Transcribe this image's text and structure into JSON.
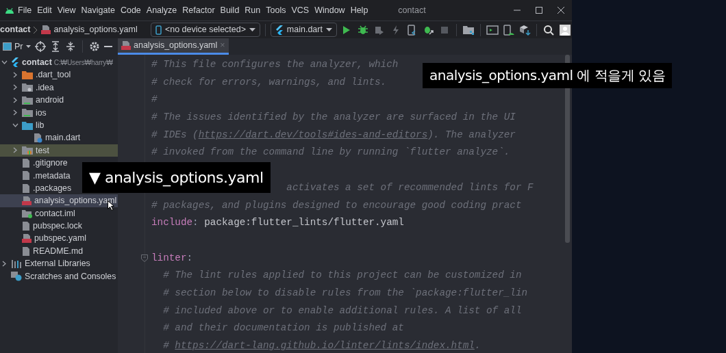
{
  "window": {
    "title": "contact"
  },
  "menu": [
    "File",
    "Edit",
    "View",
    "Navigate",
    "Code",
    "Analyze",
    "Refactor",
    "Build",
    "Run",
    "Tools",
    "VCS",
    "Window",
    "Help"
  ],
  "breadcrumb": [
    {
      "label": "contact",
      "kind": "project"
    },
    {
      "label": "analysis_options.yaml",
      "kind": "yaml-file"
    }
  ],
  "device_selector": {
    "label": "<no device selected>"
  },
  "run_config": {
    "label": "main.dart"
  },
  "project_view": {
    "label": "Pr"
  },
  "editor_tabs": [
    {
      "label": "analysis_options.yaml",
      "close": "×",
      "selected": true
    }
  ],
  "project_tree": [
    {
      "label": "contact",
      "path": "C:₩Users₩harry₩",
      "kind": "flutter",
      "expanded": true,
      "selected": false,
      "highlighted": false,
      "children": [
        {
          "label": ".dart_tool",
          "kind": "folder-excluded",
          "expanded": false,
          "selected": false,
          "highlighted": false
        },
        {
          "label": ".idea",
          "kind": "folder-config",
          "expanded": false,
          "selected": false,
          "highlighted": false
        },
        {
          "label": "android",
          "kind": "folder-module",
          "expanded": false,
          "selected": false,
          "highlighted": false
        },
        {
          "label": "ios",
          "kind": "folder-module",
          "expanded": false,
          "selected": false,
          "highlighted": false
        },
        {
          "label": "lib",
          "kind": "folder-source",
          "expanded": true,
          "selected": false,
          "highlighted": false,
          "children": [
            {
              "label": "main.dart",
              "kind": "dart-file",
              "selected": false,
              "highlighted": false
            }
          ]
        },
        {
          "label": "test",
          "kind": "folder-test",
          "expanded": false,
          "selected": false,
          "highlighted": true
        },
        {
          "label": ".gitignore",
          "kind": "file",
          "selected": false,
          "highlighted": false
        },
        {
          "label": ".metadata",
          "kind": "file",
          "selected": false,
          "highlighted": false
        },
        {
          "label": ".packages",
          "kind": "file",
          "selected": false,
          "highlighted": false
        },
        {
          "label": "analysis_options.yaml",
          "kind": "yaml-file",
          "selected": true,
          "highlighted": false
        },
        {
          "label": "contact.iml",
          "kind": "module-file",
          "selected": false,
          "highlighted": false
        },
        {
          "label": "pubspec.lock",
          "kind": "file",
          "selected": false,
          "highlighted": false
        },
        {
          "label": "pubspec.yaml",
          "kind": "yaml-file",
          "selected": false,
          "highlighted": false
        },
        {
          "label": "README.md",
          "kind": "file",
          "selected": false,
          "highlighted": false
        }
      ]
    },
    {
      "label": "External Libraries",
      "kind": "libraries",
      "expanded": false,
      "selected": false,
      "highlighted": false
    },
    {
      "label": "Scratches and Consoles",
      "kind": "scratches",
      "selected": false,
      "highlighted": false
    }
  ],
  "code_lines": [
    {
      "kind": "full",
      "foldable": false,
      "segments": [
        {
          "kind": "comment",
          "text": "# This file configures the analyzer, which"
        }
      ]
    },
    {
      "kind": "full",
      "foldable": false,
      "segments": [
        {
          "kind": "comment",
          "text": "# check for errors, warnings, and lints."
        }
      ]
    },
    {
      "kind": "full",
      "foldable": false,
      "segments": [
        {
          "kind": "comment",
          "text": "#"
        }
      ]
    },
    {
      "kind": "full",
      "foldable": false,
      "segments": [
        {
          "kind": "comment",
          "text": "# The issues identified by the analyzer are surfaced in the UI"
        }
      ]
    },
    {
      "kind": "full",
      "foldable": false,
      "segments": [
        {
          "kind": "comment",
          "text": "# IDEs ("
        },
        {
          "kind": "link",
          "text": "https://dart.dev/tools#ides-and-editors"
        },
        {
          "kind": "comment",
          "text": "). The analyzer"
        }
      ]
    },
    {
      "kind": "full",
      "foldable": false,
      "segments": [
        {
          "kind": "comment",
          "text": "# invoked from the command line by running `flutter analyze`."
        }
      ]
    },
    {
      "kind": "blank"
    },
    {
      "kind": "partial",
      "segments": [
        {
          "kind": "comment",
          "text": "activates a set of recommended lints for F"
        }
      ]
    },
    {
      "kind": "full",
      "foldable": false,
      "segments": [
        {
          "kind": "comment",
          "text": "# packages, and plugins designed to encourage good coding pract"
        }
      ]
    },
    {
      "kind": "full",
      "foldable": false,
      "segments": [
        {
          "kind": "keyword",
          "text": "include"
        },
        {
          "kind": "punct",
          "text": ": "
        },
        {
          "kind": "plain",
          "text": "package:flutter_lints/flutter.yaml"
        }
      ]
    },
    {
      "kind": "blank"
    },
    {
      "kind": "full",
      "foldable": true,
      "segments": [
        {
          "kind": "keyword",
          "text": "linter"
        },
        {
          "kind": "punct",
          "text": ":"
        }
      ]
    },
    {
      "kind": "indented",
      "foldable": false,
      "segments": [
        {
          "kind": "comment",
          "text": "# The lint rules applied to this project can be customized in"
        }
      ]
    },
    {
      "kind": "indented",
      "foldable": false,
      "segments": [
        {
          "kind": "comment",
          "text": "# section below to disable rules from the `package:flutter_lin"
        }
      ]
    },
    {
      "kind": "indented",
      "foldable": false,
      "segments": [
        {
          "kind": "comment",
          "text": "# included above or to enable additional rules. A list of all"
        }
      ]
    },
    {
      "kind": "indented",
      "foldable": false,
      "segments": [
        {
          "kind": "comment",
          "text": "# and their documentation is published at"
        }
      ]
    },
    {
      "kind": "indented",
      "foldable": false,
      "segments": [
        {
          "kind": "comment",
          "text": "# "
        },
        {
          "kind": "link",
          "text": "https://dart-lang.github.io/linter/lints/index.html"
        },
        {
          "kind": "comment",
          "text": "."
        }
      ]
    }
  ],
  "captions": [
    {
      "text": "analysis_options.yaml 에 적을게 있음"
    },
    {
      "text": "▼ analysis_options.yaml"
    }
  ]
}
